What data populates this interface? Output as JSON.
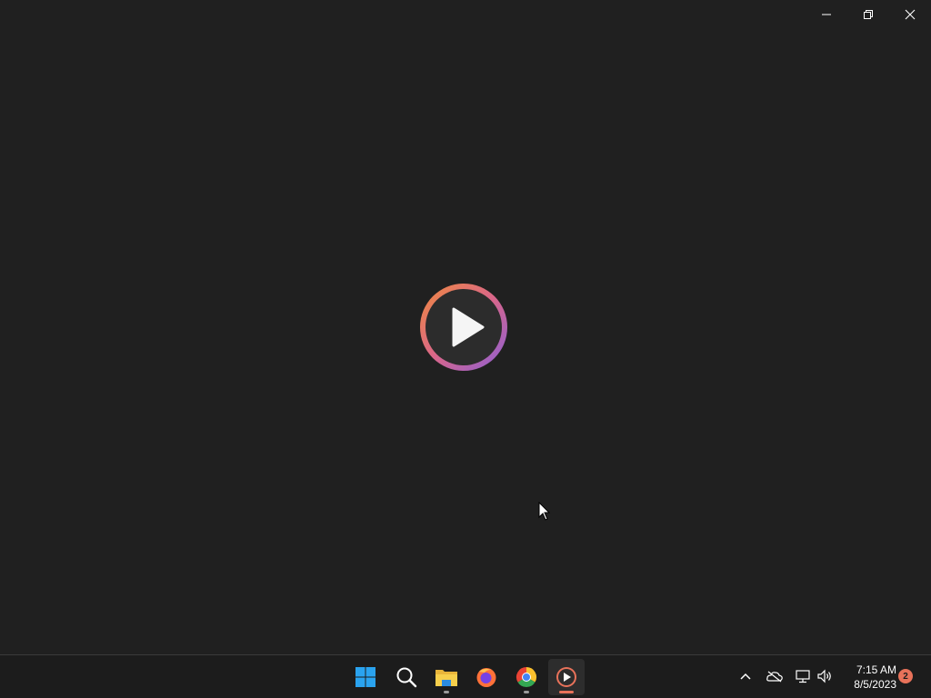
{
  "window": {
    "controls": {
      "minimize_icon": "minimize-icon",
      "restore_icon": "restore-icon",
      "close_icon": "close-icon"
    },
    "splash_icon": "media-player-logo"
  },
  "taskbar": {
    "apps": [
      {
        "name": "start",
        "icon": "windows-icon",
        "running": false
      },
      {
        "name": "search",
        "icon": "search-icon",
        "running": false
      },
      {
        "name": "file-explorer",
        "icon": "folder-icon",
        "running": true
      },
      {
        "name": "firefox",
        "icon": "firefox-icon",
        "running": false
      },
      {
        "name": "chrome",
        "icon": "chrome-icon",
        "running": true
      },
      {
        "name": "media-player",
        "icon": "media-player-icon",
        "running": true,
        "active": true
      }
    ],
    "tray": {
      "icons": [
        "chevron-up-icon",
        "onedrive-offline-icon",
        "network-icon",
        "volume-icon"
      ],
      "time": "7:15 AM",
      "date": "8/5/2023",
      "notification_count": "2"
    }
  },
  "colors": {
    "background": "#202020",
    "taskbar": "#1c1c1c",
    "accent": "#e8725a"
  }
}
